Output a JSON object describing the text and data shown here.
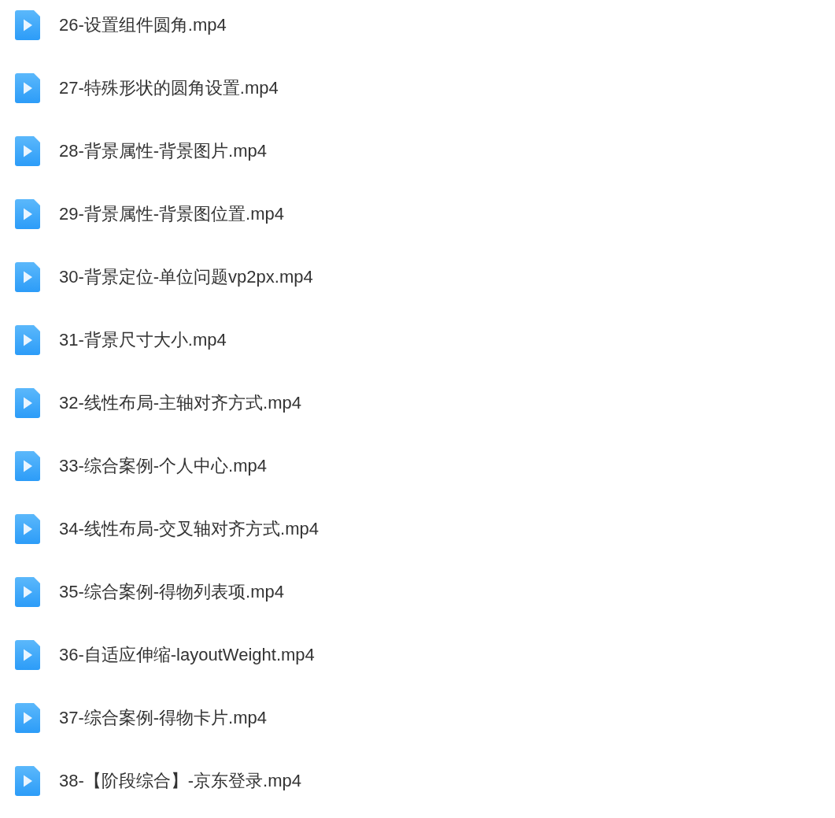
{
  "files": [
    {
      "name": "26-设置组件圆角.mp4"
    },
    {
      "name": "27-特殊形状的圆角设置.mp4"
    },
    {
      "name": "28-背景属性-背景图片.mp4"
    },
    {
      "name": "29-背景属性-背景图位置.mp4"
    },
    {
      "name": "30-背景定位-单位问题vp2px.mp4"
    },
    {
      "name": "31-背景尺寸大小.mp4"
    },
    {
      "name": "32-线性布局-主轴对齐方式.mp4"
    },
    {
      "name": "33-综合案例-个人中心.mp4"
    },
    {
      "name": "34-线性布局-交叉轴对齐方式.mp4"
    },
    {
      "name": "35-综合案例-得物列表项.mp4"
    },
    {
      "name": "36-自适应伸缩-layoutWeight.mp4"
    },
    {
      "name": "37-综合案例-得物卡片.mp4"
    },
    {
      "name": "38-【阶段综合】-京东登录.mp4"
    }
  ]
}
